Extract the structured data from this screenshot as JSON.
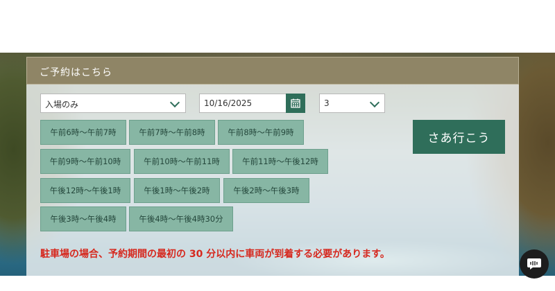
{
  "booking": {
    "header_title": "ご予約はこちら",
    "ticket_type": {
      "selected": "入場のみ",
      "icon": "chevron-down-icon"
    },
    "date": {
      "value": "10/16/2025",
      "icon": "calendar-icon"
    },
    "quantity": {
      "selected": "3",
      "icon": "chevron-down-icon"
    },
    "time_slots": [
      "午前6時〜午前7時",
      "午前7時〜午前8時",
      "午前8時〜午前9時",
      "午前9時〜午前10時",
      "午前10時〜午前11時",
      "午前11時〜午後12時",
      "午後12時〜午後1時",
      "午後1時〜午後2時",
      "午後2時〜午後3時",
      "午後3時〜午後4時",
      "午後4時〜午後4時30分"
    ],
    "submit_label": "さあ行こう",
    "notice": "駐車場の場合、予約期間の最初の 30 分以内に車両が到着する必要があります。"
  },
  "chat": {
    "icon": "chat-icon"
  },
  "colors": {
    "header_bg": "#8f8566",
    "accent_green": "#2f6e5a",
    "slot_bg": "#87b6a4",
    "notice_red": "#d6281e"
  }
}
